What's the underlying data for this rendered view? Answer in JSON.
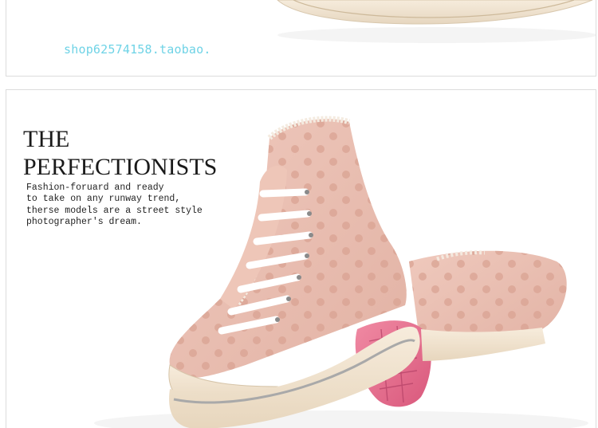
{
  "watermark": {
    "text": "shop62574158.taobao."
  },
  "banner": {
    "headline_line1": "THE",
    "headline_line2": "PERFECTIONISTS",
    "tagline": [
      "Fashion-foruard and ready",
      "to take on any runway trend,",
      "therse models are a street style",
      "photographer's dream."
    ]
  },
  "product_image": {
    "subject": "pink polka-dot high-top canvas sneakers",
    "colors": {
      "canvas": "#e8bdb0",
      "dots": "#dca79a",
      "sole": "#f3e6d4",
      "laces": "#ffffff",
      "outsole_pink": "#e56f8f"
    }
  }
}
